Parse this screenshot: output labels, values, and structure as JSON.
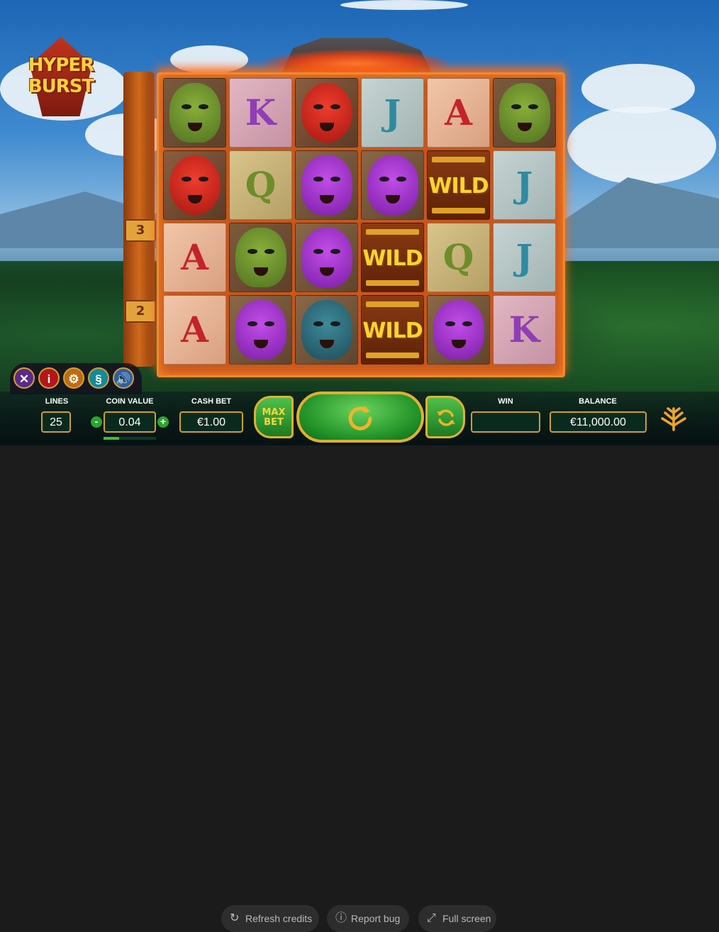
{
  "game": {
    "logo_line1": "HYPER",
    "logo_line2": "BURST"
  },
  "totem": {
    "multiplier_top": "3",
    "multiplier_bottom": "2"
  },
  "reels": {
    "rows": [
      [
        {
          "type": "mask",
          "variant": "green"
        },
        {
          "type": "letter",
          "symbol": "K"
        },
        {
          "type": "mask",
          "variant": "red"
        },
        {
          "type": "letter",
          "symbol": "J"
        },
        {
          "type": "letter",
          "symbol": "A"
        },
        {
          "type": "mask",
          "variant": "green"
        }
      ],
      [
        {
          "type": "mask",
          "variant": "red"
        },
        {
          "type": "letter",
          "symbol": "Q"
        },
        {
          "type": "mask",
          "variant": "purple"
        },
        {
          "type": "mask",
          "variant": "purple"
        },
        {
          "type": "wild",
          "symbol": "WILD"
        },
        {
          "type": "letter",
          "symbol": "J"
        }
      ],
      [
        {
          "type": "letter",
          "symbol": "A"
        },
        {
          "type": "mask",
          "variant": "green"
        },
        {
          "type": "mask",
          "variant": "purple"
        },
        {
          "type": "wild",
          "symbol": "WILD"
        },
        {
          "type": "letter",
          "symbol": "Q"
        },
        {
          "type": "letter",
          "symbol": "J"
        }
      ],
      [
        {
          "type": "letter",
          "symbol": "A"
        },
        {
          "type": "mask",
          "variant": "purple"
        },
        {
          "type": "mask",
          "variant": "blue"
        },
        {
          "type": "wild",
          "symbol": "WILD"
        },
        {
          "type": "mask",
          "variant": "purple"
        },
        {
          "type": "letter",
          "symbol": "K"
        }
      ]
    ]
  },
  "tools": {
    "close_icon": "close-icon",
    "info_icon": "info-icon",
    "settings_icon": "gear-icon",
    "rules_icon": "section-icon",
    "sound_icon": "speaker-icon"
  },
  "controls": {
    "lines_label": "LINES",
    "lines_value": "25",
    "coin_value_label": "COIN VALUE",
    "coin_value": "0.04",
    "coin_minus": "-",
    "coin_plus": "+",
    "cash_bet_label": "CASH BET",
    "cash_bet_value": "€1.00",
    "max_bet_line1": "MAX",
    "max_bet_line2": "BET",
    "win_label": "WIN",
    "win_value": "",
    "balance_label": "BALANCE",
    "balance_value": "€11,000.00"
  },
  "footer": {
    "refresh_label": "Refresh credits",
    "report_label": "Report bug",
    "fullscreen_label": "Full screen"
  },
  "colors": {
    "accent_gold": "#e0b030",
    "spin_green": "#1f8f27",
    "frame_orange": "#f08a2b"
  }
}
